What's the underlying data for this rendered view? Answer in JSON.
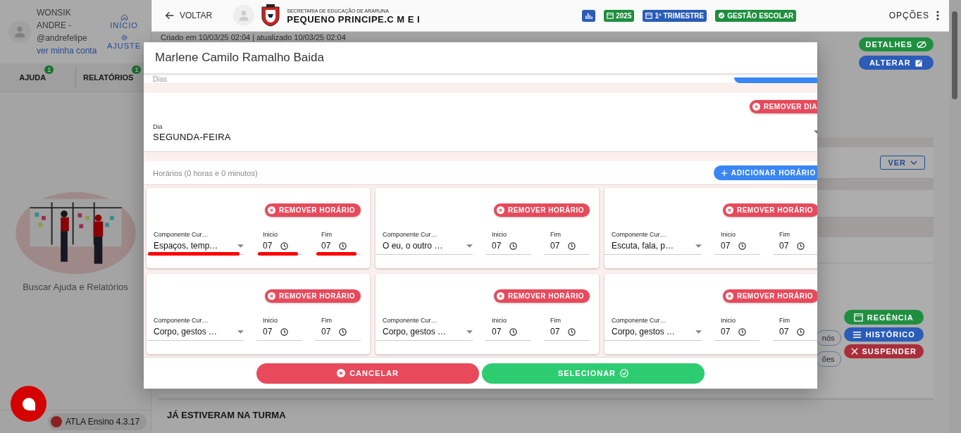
{
  "sidebar": {
    "user": {
      "name": "WONSIK ANDRE -",
      "handle": "@andrefelipe",
      "account_link": "ver minha conta"
    },
    "nav_links": [
      {
        "label": "INÍCIO",
        "kind": "home"
      },
      {
        "label": "AJUSTE",
        "kind": "gear"
      }
    ],
    "tabs": [
      {
        "label": "AJUDA",
        "badge": "1",
        "selected": false
      },
      {
        "label": "RELATÓRIOS",
        "badge": "1",
        "selected": false
      }
    ],
    "empty_state": "Buscar Ajuda e Relatórios",
    "version": "ATLA Ensino 4.3.17"
  },
  "topbar": {
    "back": "VOLTAR",
    "org_subtitle": "SECRETARIA DE EDUCAÇÃO DE ARARUNA",
    "org_name": "PEQUENO PRINCIPE.C M E I",
    "chips": [
      {
        "kind": "chart",
        "color": "#2a5cb8"
      },
      {
        "kind": "calendar",
        "label": "2025",
        "color": "#1f8f3f"
      },
      {
        "kind": "calendar",
        "label": "1º TRIMESTRE",
        "color": "#2a5cb8"
      },
      {
        "kind": "check",
        "label": "GESTÃO ESCOLAR",
        "color": "#1f8f3f"
      }
    ],
    "options": "OPÇÕES"
  },
  "page": {
    "meta": "Criado em 10/03/25 02:04 | atualizado 10/03/25 02:04",
    "top_actions": [
      {
        "label": "DETALHES",
        "kind": "eye-off",
        "color": "#1f8f3f"
      },
      {
        "label": "ALTERAR",
        "kind": "edit",
        "color": "#2a5cb8"
      }
    ],
    "ver": "VER",
    "chips": [
      "nós",
      "ões"
    ],
    "side_actions": [
      {
        "label": "REGÊNCIA",
        "kind": "calendar",
        "color": "#1f8f3f"
      },
      {
        "label": "HISTÓRICO",
        "kind": "list",
        "color": "#2a5cb8"
      },
      {
        "label": "SUSPENDER",
        "kind": "close",
        "color": "#a92e3a"
      }
    ],
    "section_title": "JÁ ESTIVERAM NA TURMA"
  },
  "modal": {
    "title": "Marlene Camilo Ramalho Baida",
    "days_label": "Dias",
    "remove_day": "REMOVER DIA",
    "day_field": {
      "label": "Dia",
      "value": "SEGUNDA-FEIRA"
    },
    "hours_label": "Horários (0 horas e 0 minutos)",
    "add_hour": "ADICIONAR HORÁRIO",
    "slots": [
      {
        "remove": "REMOVER HORÁRIO",
        "component_label": "Componente Cur…",
        "component": "Espaços, temp…",
        "start_label": "Inicio",
        "start": "07",
        "end_label": "Fim",
        "end": "07",
        "marked": true
      },
      {
        "remove": "REMOVER HORÁRIO",
        "component_label": "Componente Cur…",
        "component": "O eu, o outro …",
        "start_label": "Inicio",
        "start": "07",
        "end_label": "Fim",
        "end": "07",
        "marked": false
      },
      {
        "remove": "REMOVER HORÁRIO",
        "component_label": "Componente Cur…",
        "component": "Escuta, fala, p…",
        "start_label": "Inicio",
        "start": "07",
        "end_label": "Fim",
        "end": "07",
        "marked": false
      },
      {
        "remove": "REMOVER HORÁRIO",
        "component_label": "Componente Cur…",
        "component": "Corpo, gestos …",
        "start_label": "Inicio",
        "start": "07",
        "end_label": "Fim",
        "end": "07",
        "marked": false
      },
      {
        "remove": "REMOVER HORÁRIO",
        "component_label": "Componente Cur…",
        "component": "Corpo, gestos …",
        "start_label": "Inicio",
        "start": "07",
        "end_label": "Fim",
        "end": "07",
        "marked": false
      },
      {
        "remove": "REMOVER HORÁRIO",
        "component_label": "Componente Cur…",
        "component": "Corpo, gestos …",
        "start_label": "Inicio",
        "start": "07",
        "end_label": "Fim",
        "end": "07",
        "marked": false
      }
    ],
    "cancel": "CANCELAR",
    "select": "SELECIONAR"
  }
}
